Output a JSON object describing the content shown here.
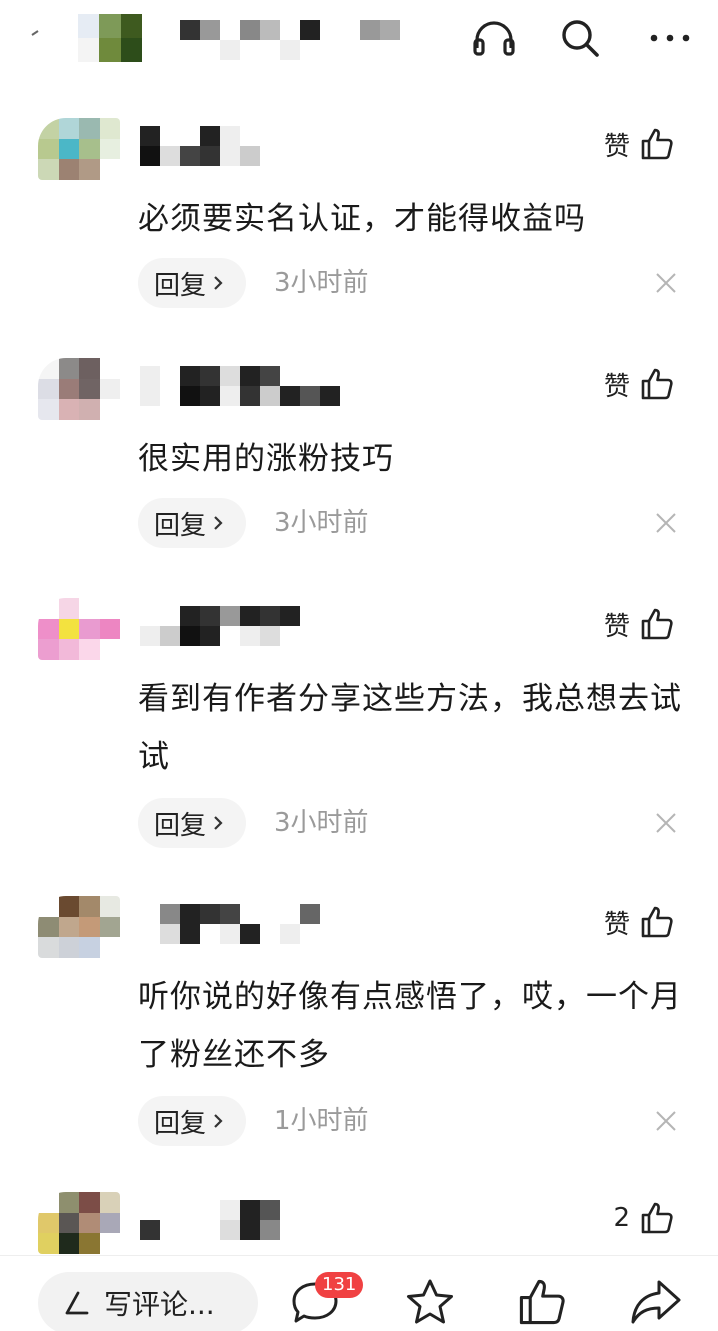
{
  "comments": [
    {
      "text": "必须要实名认证，才能得收益吗",
      "like_label": "赞",
      "reply_label": "回复",
      "time": "3小时前"
    },
    {
      "text": "很实用的涨粉技巧",
      "like_label": "赞",
      "reply_label": "回复",
      "time": "3小时前"
    },
    {
      "text": "看到有作者分享这些方法，我总想去试试",
      "like_label": "赞",
      "reply_label": "回复",
      "time": "3小时前"
    },
    {
      "text": "听你说的好像有点感悟了，哎，一个月了粉丝还不多",
      "like_label": "赞",
      "reply_label": "回复",
      "time": "1小时前"
    },
    {
      "like_label": "2"
    }
  ],
  "bottom_bar": {
    "write_placeholder": "写评论...",
    "comment_count": "131"
  },
  "icons": {
    "top": [
      "headphones-icon",
      "search-icon",
      "more-icon"
    ],
    "bottom": [
      "pen-icon",
      "comment-icon",
      "star-icon",
      "thumbs-up-icon",
      "share-icon"
    ]
  }
}
